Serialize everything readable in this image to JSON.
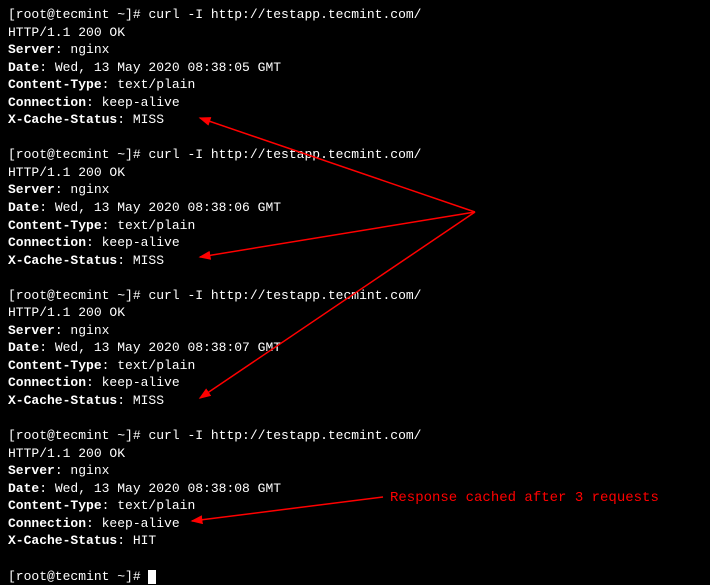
{
  "prompt": {
    "user_host": "[root@tecmint ~]",
    "hash": "# ",
    "command": "curl -I http://testapp.tecmint.com/"
  },
  "blocks": [
    {
      "status": "HTTP/1.1 200 OK",
      "server_label": "Server",
      "server_value": ": nginx",
      "date_label": "Date",
      "date_value": ": Wed, 13 May 2020 08:38:05 GMT",
      "ctype_label": "Content-Type",
      "ctype_value": ": text/plain",
      "conn_label": "Connection",
      "conn_value": ": keep-alive",
      "cache_label": "X-Cache-Status",
      "cache_value": ": MISS"
    },
    {
      "status": "HTTP/1.1 200 OK",
      "server_label": "Server",
      "server_value": ": nginx",
      "date_label": "Date",
      "date_value": ": Wed, 13 May 2020 08:38:06 GMT",
      "ctype_label": "Content-Type",
      "ctype_value": ": text/plain",
      "conn_label": "Connection",
      "conn_value": ": keep-alive",
      "cache_label": "X-Cache-Status",
      "cache_value": ": MISS"
    },
    {
      "status": "HTTP/1.1 200 OK",
      "server_label": "Server",
      "server_value": ": nginx",
      "date_label": "Date",
      "date_value": ": Wed, 13 May 2020 08:38:07 GMT",
      "ctype_label": "Content-Type",
      "ctype_value": ": text/plain",
      "conn_label": "Connection",
      "conn_value": ": keep-alive",
      "cache_label": "X-Cache-Status",
      "cache_value": ": MISS"
    },
    {
      "status": "HTTP/1.1 200 OK",
      "server_label": "Server",
      "server_value": ": nginx",
      "date_label": "Date",
      "date_value": ": Wed, 13 May 2020 08:38:08 GMT",
      "ctype_label": "Content-Type",
      "ctype_value": ": text/plain",
      "conn_label": "Connection",
      "conn_value": ": keep-alive",
      "cache_label": "X-Cache-Status",
      "cache_value": ": HIT"
    }
  ],
  "annotation": "Response cached after 3 requests"
}
